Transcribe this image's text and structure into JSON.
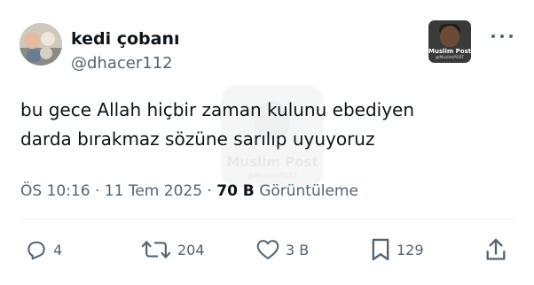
{
  "author": {
    "display_name": "kedi çobanı",
    "handle": "@dhacer112"
  },
  "badge": {
    "title": "Muslim Post",
    "subtitle": "@MuslimPOST"
  },
  "tweet": {
    "line1": "bu gece Allah hiçbir zaman kulunu ebediyen",
    "line2": "darda bırakmaz sözüne sarılıp uyuyoruz"
  },
  "watermark": {
    "title": "Muslim Post",
    "subtitle": "@MuslimPOST"
  },
  "meta": {
    "time": "ÖS 10:16",
    "separator": "·",
    "date": "11 Tem 2025",
    "views_count": "70 B",
    "views_label": "Görüntüleme"
  },
  "actions": {
    "replies": "4",
    "reposts": "204",
    "likes": "3 B",
    "bookmarks": "129"
  },
  "icons": {
    "more": "more-options-icon",
    "reply": "reply-icon",
    "repost": "repost-icon",
    "like": "heart-icon",
    "bookmark": "bookmark-icon",
    "share": "share-icon"
  },
  "colors": {
    "text_primary": "#0f1419",
    "text_secondary": "#536471",
    "divider": "#eff3f4"
  }
}
